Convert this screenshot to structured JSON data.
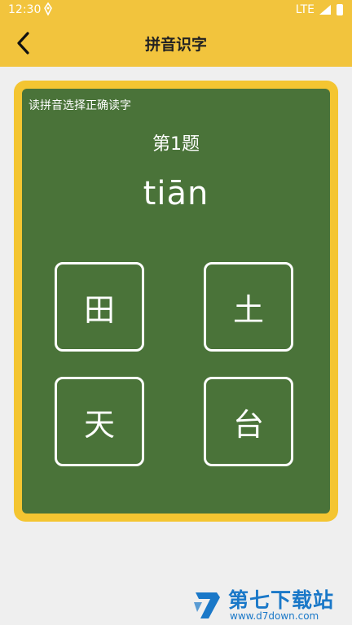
{
  "status_bar": {
    "time": "12:30",
    "network": "LTE"
  },
  "app_bar": {
    "title": "拼音识字"
  },
  "quiz": {
    "instruction": "读拼音选择正确读字",
    "question_number": "第1题",
    "pinyin": "tiān",
    "options": [
      {
        "char": "田"
      },
      {
        "char": "土"
      },
      {
        "char": "天"
      },
      {
        "char": "台"
      }
    ]
  },
  "watermark": {
    "name": "第七下载站",
    "url": "www.d7down.com"
  },
  "colors": {
    "app_bar": "#f2c43d",
    "board": "#4a7339",
    "frame": "#f4c531",
    "watermark": "#1a78c8"
  },
  "icons": [
    "back-arrow-icon",
    "gps-icon",
    "signal-icon",
    "battery-icon",
    "d7-logo-icon"
  ]
}
